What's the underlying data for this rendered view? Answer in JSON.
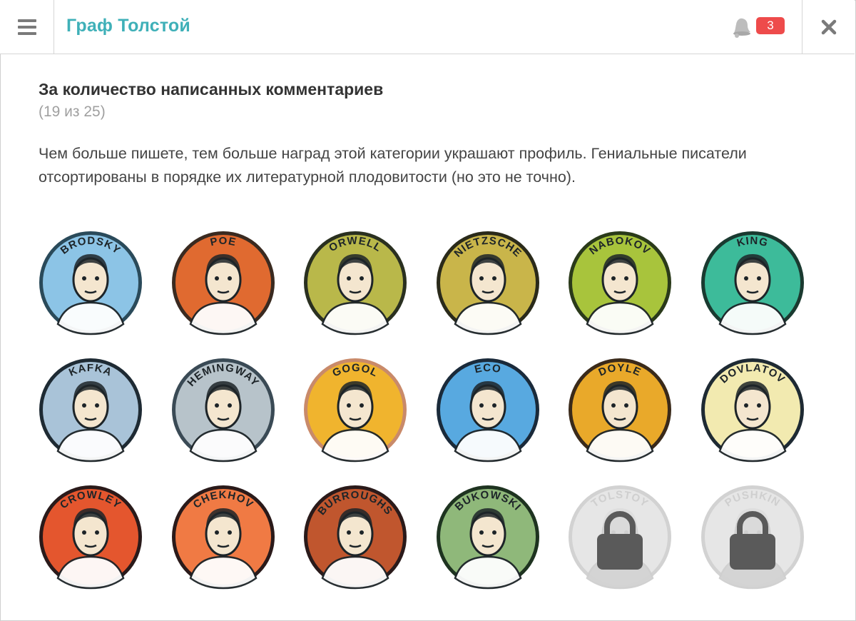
{
  "header": {
    "title": "Граф Толстой",
    "notification_count": "3"
  },
  "section": {
    "heading": "За количество написанных комментариев",
    "progress_text": "(19 из 25)",
    "description": "Чем больше пишете, тем больше наград этой категории украшают профиль. Гениальные писатели отсортированы в порядке их литературной плодовитости (но это не точно)."
  },
  "badges": [
    {
      "name": "BRODSKY",
      "color": "#8cc4e6",
      "rim": "#2a4a5a",
      "locked": false
    },
    {
      "name": "POE",
      "color": "#e06a30",
      "rim": "#3a2a20",
      "locked": false
    },
    {
      "name": "ORWELL",
      "color": "#b9b84a",
      "rim": "#2a3020",
      "locked": false
    },
    {
      "name": "NIETZSCHE",
      "color": "#c9b54a",
      "rim": "#2a2a1a",
      "locked": false
    },
    {
      "name": "NABOKOV",
      "color": "#a8c43c",
      "rim": "#2a3a1a",
      "locked": false
    },
    {
      "name": "KING",
      "color": "#3dbb9a",
      "rim": "#1a3a30",
      "locked": false
    },
    {
      "name": "KAFKA",
      "color": "#a9c3d8",
      "rim": "#1e2a33",
      "locked": false
    },
    {
      "name": "HEMINGWAY",
      "color": "#b7c3ca",
      "rim": "#3a4a55",
      "locked": false
    },
    {
      "name": "GOGOL",
      "color": "#f0b42e",
      "rim": "#c98a6a",
      "locked": false
    },
    {
      "name": "ECO",
      "color": "#58a9e0",
      "rim": "#1a2a3a",
      "locked": false
    },
    {
      "name": "DOYLE",
      "color": "#e9a92a",
      "rim": "#3a2a1a",
      "locked": false
    },
    {
      "name": "DOVLATOV",
      "color": "#f2eab0",
      "rim": "#1e2a33",
      "locked": false
    },
    {
      "name": "CROWLEY",
      "color": "#e4562e",
      "rim": "#2a1a1a",
      "locked": false
    },
    {
      "name": "CHEKHOV",
      "color": "#f07a44",
      "rim": "#2a1a1a",
      "locked": false
    },
    {
      "name": "BURROUGHS",
      "color": "#c0562e",
      "rim": "#2a1a1a",
      "locked": false
    },
    {
      "name": "BUKOWSKI",
      "color": "#8fb87a",
      "rim": "#1e3320",
      "locked": false
    },
    {
      "name": "TOLSTOY",
      "color": "#e6e6e6",
      "rim": "#d2d2d2",
      "locked": true
    },
    {
      "name": "PUSHKIN",
      "color": "#e6e6e6",
      "rim": "#d2d2d2",
      "locked": true
    }
  ]
}
